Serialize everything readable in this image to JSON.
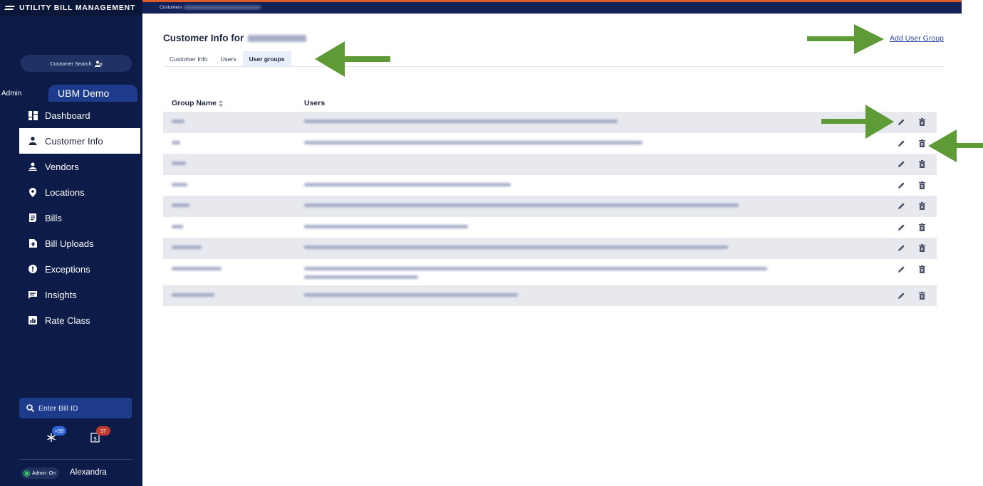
{
  "app": {
    "brand": "UTILITY BILL MANAGEMENT"
  },
  "sidebar": {
    "customer_search": "Customer Search",
    "admin_label": "Admin",
    "org_tab": "UBM Demo",
    "items": [
      {
        "label": "Dashboard",
        "icon": "dashboard-icon"
      },
      {
        "label": "Customer Info",
        "icon": "person-icon",
        "active": true
      },
      {
        "label": "Vendors",
        "icon": "vendor-icon"
      },
      {
        "label": "Locations",
        "icon": "location-pin-icon"
      },
      {
        "label": "Bills",
        "icon": "bill-icon"
      },
      {
        "label": "Bill Uploads",
        "icon": "upload-icon"
      },
      {
        "label": "Exceptions",
        "icon": "exclamation-icon"
      },
      {
        "label": "Insights",
        "icon": "insights-icon"
      },
      {
        "label": "Rate Class",
        "icon": "rate-class-icon"
      }
    ],
    "bill_search_placeholder": "Enter Bill ID",
    "notifications": {
      "asterisk_count": "+99",
      "bill_count": "37"
    },
    "admin_toggle": "Admin: On",
    "user_name": "Alexandra"
  },
  "topbar": {
    "breadcrumb_root": "Customers"
  },
  "page": {
    "title_prefix": "Customer Info for",
    "add_user_group": "Add User Group",
    "tabs": [
      {
        "label": "Customer Info"
      },
      {
        "label": "Users"
      },
      {
        "label": "User groups",
        "active": true
      }
    ]
  },
  "table": {
    "headers": {
      "group_name": "Group Name",
      "users": "Users"
    },
    "rows": [
      {
        "group_w": 18,
        "users_w": 440
      },
      {
        "group_w": 12,
        "users_w": 475
      },
      {
        "group_w": 20,
        "users_w": 0
      },
      {
        "group_w": 22,
        "users_w": 290
      },
      {
        "group_w": 25,
        "users_w": 610
      },
      {
        "group_w": 16,
        "users_w": 230
      },
      {
        "group_w": 42,
        "users_w": 595
      },
      {
        "group_w": 70,
        "users_w": 650,
        "tall": true
      },
      {
        "group_w": 60,
        "users_w": 300
      }
    ]
  },
  "colors": {
    "sidebar_bg": "#0c1b47",
    "accent": "#1e3a8a",
    "link": "#2f4aa8",
    "row_shade": "#e7e9ef",
    "annotation_arrow": "#5e9a35"
  }
}
